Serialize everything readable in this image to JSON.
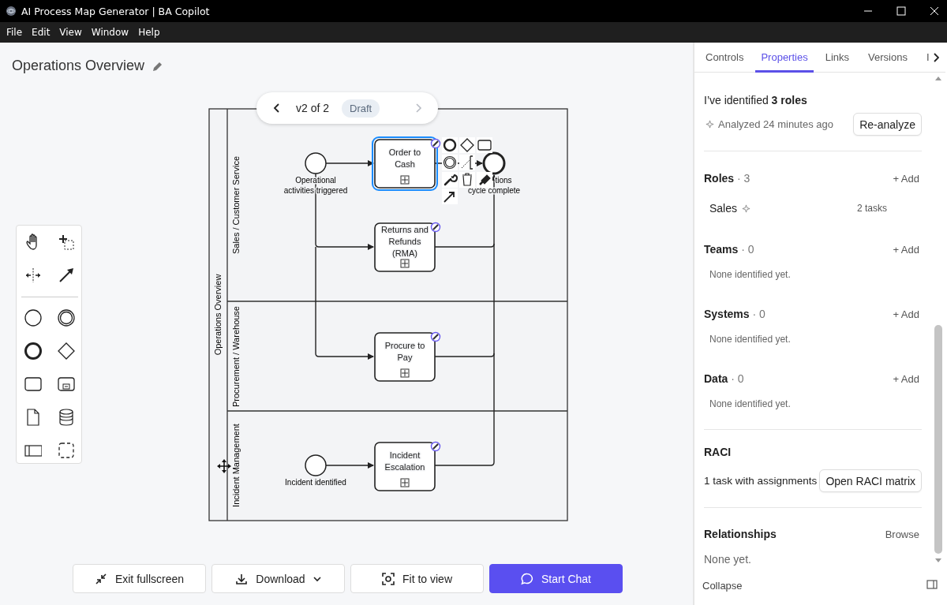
{
  "window": {
    "title": "AI Process Map Generator | BA Copilot"
  },
  "menu": [
    "File",
    "Edit",
    "View",
    "Window",
    "Help"
  ],
  "canvas": {
    "title": "Operations Overview",
    "version": {
      "label": "v2 of 2",
      "status": "Draft",
      "next_disabled": true
    },
    "pool": {
      "label": "Operations Overview",
      "lanes": [
        "Sales / Customer Service",
        "Procurement / Warehouse",
        "Incident Management"
      ]
    },
    "nodes": [
      {
        "kind": "start",
        "lines": [
          "Operational",
          "activities triggered"
        ],
        "selected": false
      },
      {
        "kind": "task",
        "lines": [
          "Order to",
          "Cash"
        ],
        "selected": true
      },
      {
        "kind": "end",
        "lines": [
          "tions",
          "cycle complete"
        ],
        "selected": false
      },
      {
        "kind": "task",
        "lines": [
          "Returns and",
          "Refunds",
          "(RMA)"
        ],
        "selected": false
      },
      {
        "kind": "task",
        "lines": [
          "Procure to",
          "Pay"
        ],
        "selected": false
      },
      {
        "kind": "start",
        "lines": [
          "Incident identified"
        ],
        "selected": false
      },
      {
        "kind": "task",
        "lines": [
          "Incident",
          "Escalation"
        ],
        "selected": false
      }
    ],
    "toolbar": [
      {
        "kind": "exit",
        "label": "Exit fullscreen"
      },
      {
        "kind": "download",
        "label": "Download"
      },
      {
        "kind": "fit",
        "label": "Fit to view"
      },
      {
        "kind": "chat",
        "label": "Start Chat"
      }
    ]
  },
  "panel": {
    "tabs": [
      {
        "label": "Controls",
        "selected": false
      },
      {
        "label": "Properties",
        "selected": true
      },
      {
        "label": "Links",
        "selected": false
      },
      {
        "label": "Versions",
        "selected": false
      },
      {
        "label": "I",
        "selected": false
      }
    ],
    "summary": "I’ve identified **3 roles**",
    "analyzed": "Analyzed 24 minutes ago",
    "reanalyze": "Re-analyze",
    "sections": [
      {
        "title": "Roles",
        "count": "· 3",
        "action": "+ Add",
        "items": [
          {
            "name": "Sales",
            "meta": "2 tasks"
          }
        ]
      },
      {
        "title": "Teams",
        "count": "· 0",
        "action": "+ Add",
        "empty": "None identified yet."
      },
      {
        "title": "Systems",
        "count": "· 0",
        "action": "+ Add",
        "empty": "None identified yet."
      },
      {
        "title": "Data",
        "count": "· 0",
        "action": "+ Add",
        "empty": "None identified yet."
      }
    ],
    "raci": {
      "title": "RACI",
      "text": "1 task with assignments",
      "button": "Open RACI matrix"
    },
    "relationships": {
      "title": "Relationships",
      "action": "Browse",
      "empty": "None yet."
    },
    "collapse": "Collapse"
  }
}
